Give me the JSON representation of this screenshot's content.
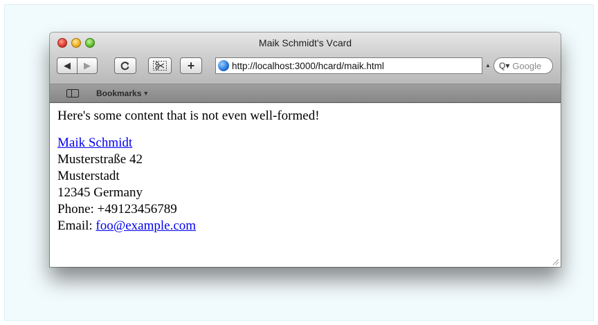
{
  "window": {
    "title": "Maik Schmidt's Vcard"
  },
  "toolbar": {
    "back_icon": "back-arrow-icon",
    "forward_icon": "forward-arrow-icon",
    "reload_icon": "reload-icon",
    "snip_icon": "scissors-icon",
    "add_label": "+"
  },
  "address_bar": {
    "url": "http://localhost:3000/hcard/maik.html"
  },
  "search": {
    "placeholder": "Google"
  },
  "bookmarks_bar": {
    "label": "Bookmarks"
  },
  "content": {
    "intro": "Here's some content that is not even well-formed!",
    "vcard": {
      "name": "Maik Schmidt",
      "street": "Musterstraße 42",
      "city": "Musterstadt",
      "postal_country": "12345 Germany",
      "phone": "Phone: +49123456789",
      "email_label": "Email:",
      "email": "foo@example.com"
    }
  },
  "colors": {
    "link": "#0000ee",
    "backdrop": "#f1fafc"
  }
}
